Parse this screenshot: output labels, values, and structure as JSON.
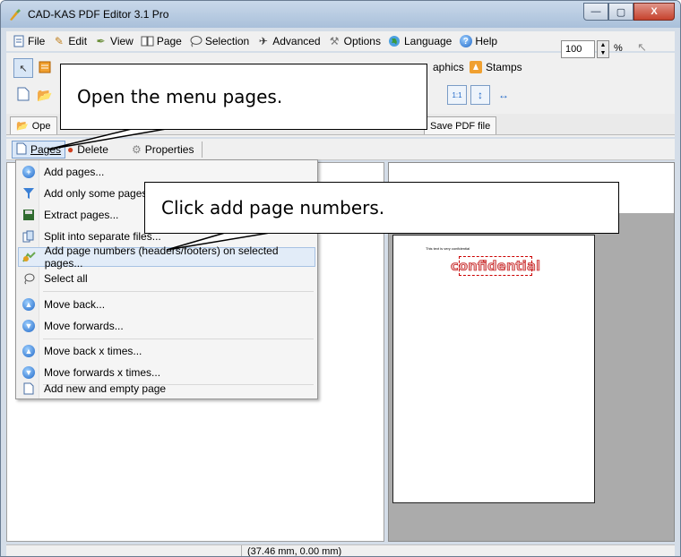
{
  "window": {
    "title": "CAD-KAS PDF Editor 3.1 Pro",
    "minimize": "—",
    "maximize": "▢",
    "close": "X"
  },
  "menubar": {
    "items": [
      "File",
      "Edit",
      "View",
      "Page",
      "Selection",
      "Advanced",
      "Options",
      "Language",
      "Help"
    ]
  },
  "toolbar": {
    "graphics_label": "aphics",
    "stamps_label": "Stamps",
    "zoom_value": "100",
    "zoom_unit": "%"
  },
  "tabs": {
    "open_label": "Ope",
    "save_label": "Save PDF file"
  },
  "pagebar": {
    "pages": "Pages",
    "delete": "Delete",
    "properties": "Properties"
  },
  "dropdown": {
    "items": [
      "Add pages...",
      "Add only some pages o",
      "Extract pages...",
      "Split into separate files...",
      "Add page numbers (headers/footers) on selected pages...",
      "Select all",
      "Move back...",
      "Move forwards...",
      "Move back x times...",
      "Move forwards x times...",
      "Add new and empty page"
    ]
  },
  "document": {
    "text_line": "This text is very confidential",
    "stamp": "confidential"
  },
  "statusbar": {
    "coordinates": "(37.46 mm, 0.00 mm)"
  },
  "callouts": {
    "menu": "Open the menu pages.",
    "page_numbers": "Click add page numbers."
  },
  "colors": {
    "highlight": "#e2ecf8",
    "stamp_red": "#c00000",
    "workspace_gray": "#ababab"
  }
}
